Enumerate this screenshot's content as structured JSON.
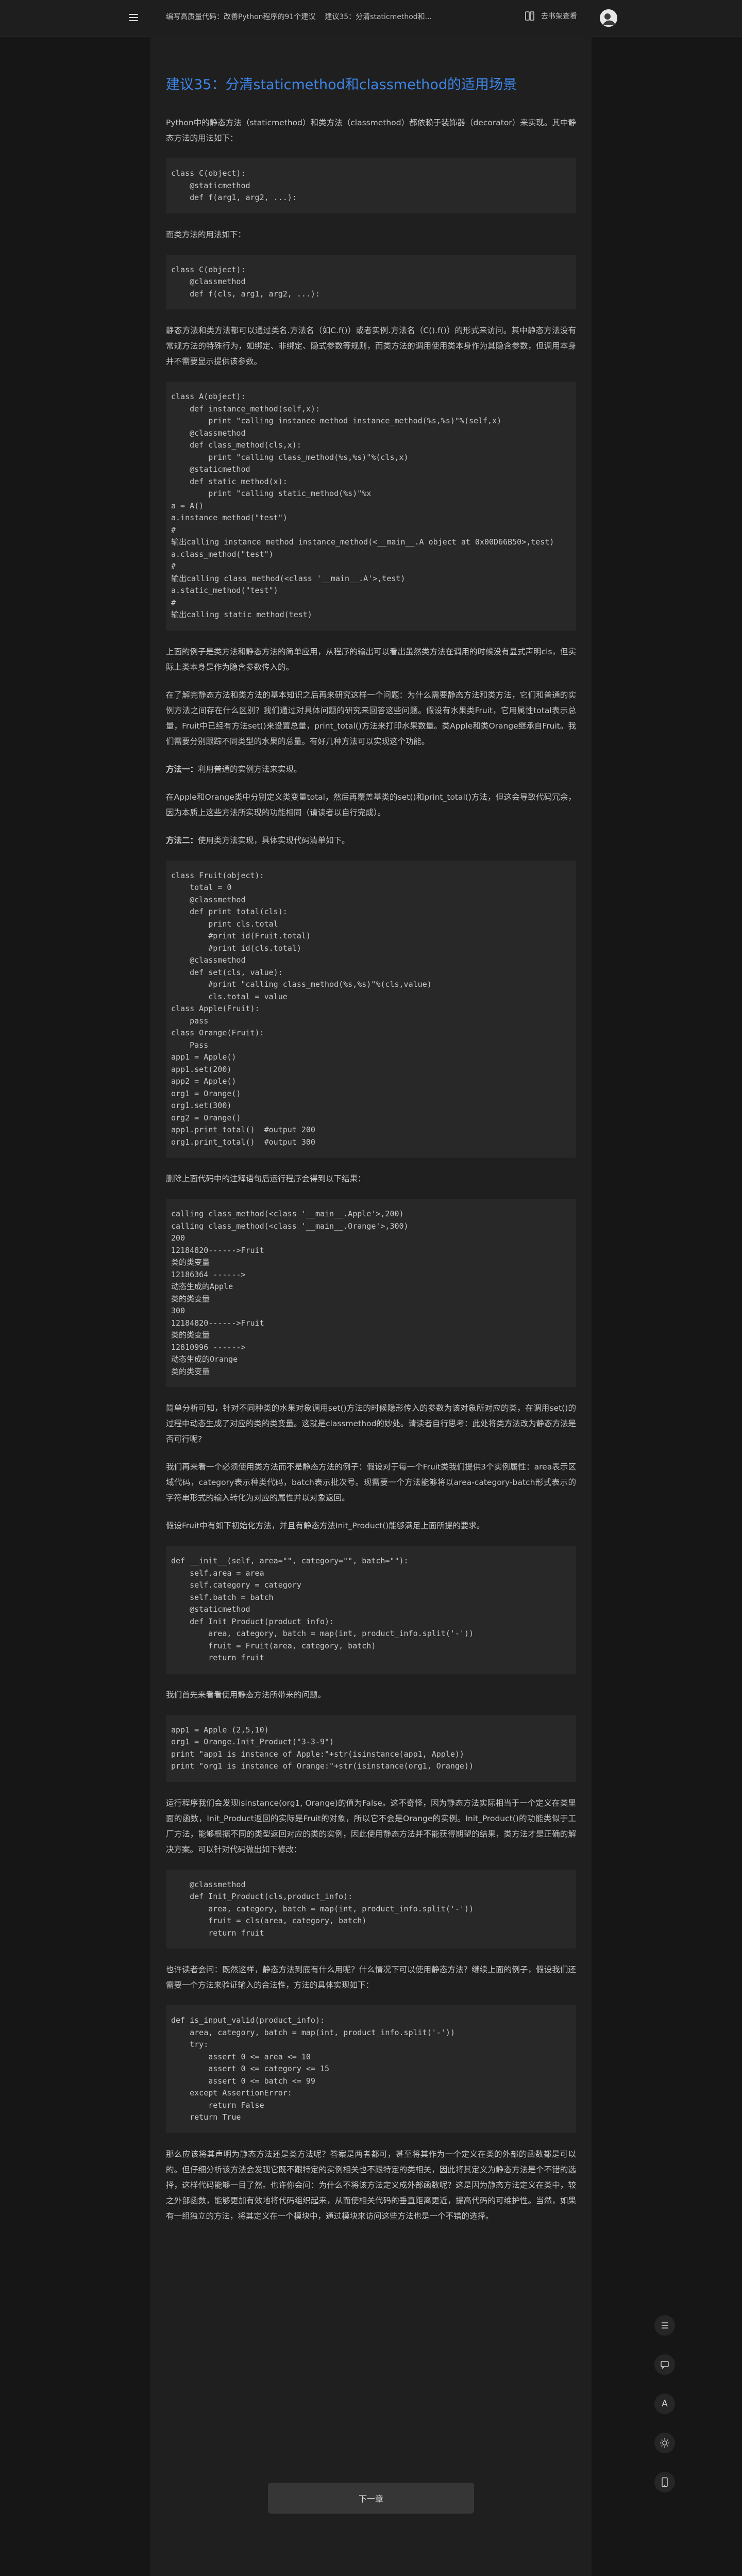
{
  "header": {
    "book_title": "编写高质量代码：改善Python程序的91个建议",
    "chapter": "建议35：分清staticmethod和...",
    "shelf_label": "去书架查看"
  },
  "article": {
    "title": "建议35：分清staticmethod和classmethod的适用场景",
    "p1": "Python中的静态方法（staticmethod）和类方法（classmethod）都依赖于装饰器（decorator）来实现。其中静态方法的用法如下：",
    "code1": "class C(object):\n    @staticmethod\n    def f(arg1, arg2, ...):",
    "p2": "而类方法的用法如下：",
    "code2": "class C(object):\n    @classmethod\n    def f(cls, arg1, arg2, ...):",
    "p3": "静态方法和类方法都可以通过类名.方法名（如C.f()）或者实例.方法名（C().f()）的形式来访问。其中静态方法没有常规方法的特殊行为，如绑定、非绑定、隐式参数等规则，而类方法的调用使用类本身作为其隐含参数，但调用本身并不需要显示提供该参数。",
    "code3": "class A(object):\n    def instance_method(self,x):\n        print \"calling instance method instance_method(%s,%s)\"%(self,x)\n    @classmethod\n    def class_method(cls,x):\n        print \"calling class_method(%s,%s)\"%(cls,x)\n    @staticmethod\n    def static_method(x):\n        print \"calling static_method(%s)\"%x\na = A()\na.instance_method(\"test\")\n#\n输出calling instance method instance_method(<__main__.A object at 0x00D66B50>,test)\na.class_method(\"test\")\n#\n输出calling class_method(<class '__main__.A'>,test)\na.static_method(\"test\")\n#\n输出calling static_method(test)",
    "p4": "上面的例子是类方法和静态方法的简单应用，从程序的输出可以看出虽然类方法在调用的时候没有显式声明cls，但实际上类本身是作为隐含参数传入的。",
    "p5": "在了解完静态方法和类方法的基本知识之后再来研究这样一个问题：为什么需要静态方法和类方法，它们和普通的实例方法之间存在什么区别？我们通过对具体问题的研究来回答这些问题。假设有水果类Fruit，它用属性total表示总量，Fruit中已经有方法set()来设置总量，print_total()方法来打印水果数量。类Apple和类Orange继承自Fruit。我们需要分别跟踪不同类型的水果的总量。有好几种方法可以实现这个功能。",
    "p6_label": "方法一：",
    "p6_text": "利用普通的实例方法来实现。",
    "p7": "在Apple和Orange类中分别定义类变量total，然后再覆盖基类的set()和print_total()方法，但这会导致代码冗余，因为本质上这些方法所实现的功能相同（请读者以自行完成）。",
    "p8_label": "方法二：",
    "p8_text": "使用类方法实现，具体实现代码清单如下。",
    "code4": "class Fruit(object):\n    total = 0\n    @classmethod\n    def print_total(cls):\n        print cls.total\n        #print id(Fruit.total)\n        #print id(cls.total)\n    @classmethod\n    def set(cls, value):\n        #print \"calling class_method(%s,%s)\"%(cls,value)\n        cls.total = value\nclass Apple(Fruit):\n    pass\nclass Orange(Fruit):\n    Pass\napp1 = Apple()\napp1.set(200)\napp2 = Apple()\norg1 = Orange()\norg1.set(300)\norg2 = Orange()\napp1.print_total()  #output 200\norg1.print_total()  #output 300",
    "p9": "删除上面代码中的注释语句后运行程序会得到以下结果：",
    "code5": "calling class_method(<class '__main__.Apple'>,200)\ncalling class_method(<class '__main__.Orange'>,300)\n200\n12184820------>Fruit\n类的类变量\n12186364 ------>\n动态生成的Apple\n类的类变量\n300\n12184820------>Fruit\n类的类变量\n12810996 ------>\n动态生成的Orange\n类的类变量",
    "p10": "简单分析可知，针对不同种类的水果对象调用set()方法的时候隐形传入的参数为该对象所对应的类，在调用set()的过程中动态生成了对应的类的类变量。这就是classmethod的妙处。请读者自行思考：此处将类方法改为静态方法是否可行呢?",
    "p11": "我们再来看一个必须使用类方法而不是静态方法的例子：假设对于每一个Fruit类我们提供3个实例属性：area表示区域代码，category表示种类代码，batch表示批次号。现需要一个方法能够将以area-category-batch形式表示的字符串形式的输入转化为对应的属性并以对象返回。",
    "p12": "假设Fruit中有如下初始化方法，并且有静态方法Init_Product()能够满足上面所提的要求。",
    "code6": "def __init__(self, area=\"\", category=\"\", batch=\"\"):\n    self.area = area\n    self.category = category\n    self.batch = batch\n    @staticmethod\n    def Init_Product(product_info):\n        area, category, batch = map(int, product_info.split('-'))\n        fruit = Fruit(area, category, batch)\n        return fruit",
    "p13": "我们首先来看看使用静态方法所带来的问题。",
    "code7": "app1 = Apple (2,5,10)\norg1 = Orange.Init_Product(\"3-3-9\")\nprint \"app1 is instance of Apple:\"+str(isinstance(app1, Apple))\nprint \"org1 is instance of Orange:\"+str(isinstance(org1, Orange))",
    "p14": "运行程序我们会发现isinstance(org1, Orange)的值为False。这不奇怪，因为静态方法实际相当于一个定义在类里面的函数，Init_Product返回的实际是Fruit的对象，所以它不会是Orange的实例。Init_Product()的功能类似于工厂方法，能够根据不同的类型返回对应的类的实例，因此使用静态方法并不能获得期望的结果，类方法才是正确的解决方案。可以针对代码做出如下修改：",
    "code8": "    @classmethod\n    def Init_Product(cls,product_info):\n        area, category, batch = map(int, product_info.split('-'))\n        fruit = cls(area, category, batch)\n        return fruit",
    "p15": "也许读者会问：既然这样，静态方法到底有什么用呢？什么情况下可以使用静态方法？继续上面的例子，假设我们还需要一个方法来验证输入的合法性，方法的具体实现如下：",
    "code9": "def is_input_valid(product_info):\n    area, category, batch = map(int, product_info.split('-'))\n    try:\n        assert 0 <= area <= 10\n        assert 0 <= category <= 15\n        assert 0 <= batch <= 99\n    except AssertionError:\n        return False\n    return True",
    "p16": "那么应该将其声明为静态方法还是类方法呢？答案是两者都可，甚至将其作为一个定义在类的外部的函数都是可以的。但仔细分析该方法会发现它既不跟特定的实例相关也不跟特定的类相关，因此将其定义为静态方法是个不错的选择，这样代码能够一目了然。也许你会问：为什么不将该方法定义成外部函数呢？这是因为静态方法定义在类中，较之外部函数，能够更加有效地将代码组织起来，从而使相关代码的垂直距离更近，提高代码的可维护性。当然，如果有一组独立的方法，将其定义在一个模块中，通过模块来访问这些方法也是一个不错的选择。"
  },
  "footer": {
    "next_label": "下一章"
  }
}
